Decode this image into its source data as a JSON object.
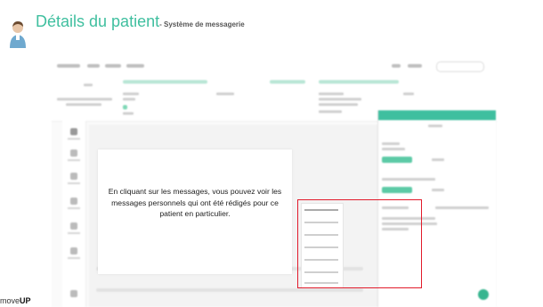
{
  "slide": {
    "title": "Détails du patient",
    "subtitle": "- Système de messagerie"
  },
  "tooltip": {
    "text": "En cliquant sur les messages, vous pouvez voir les messages personnels qui ont été rédigés pour ce patient en particulier."
  },
  "brand": {
    "prefix": "move",
    "suffix": "UP"
  },
  "colors": {
    "accent": "#3fbf9f",
    "highlight": "#e21b2b"
  }
}
